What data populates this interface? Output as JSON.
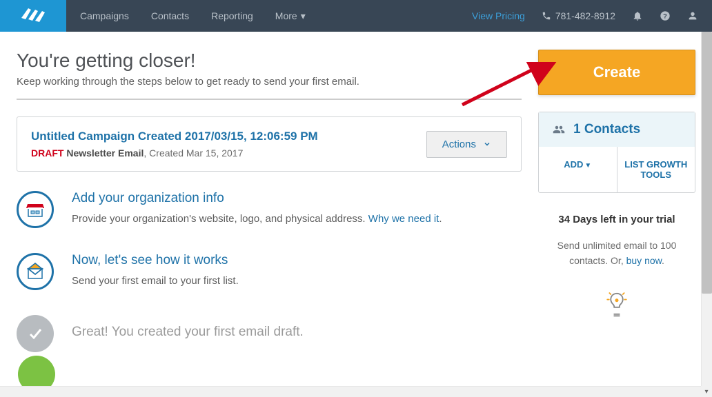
{
  "topnav": {
    "items": [
      "Campaigns",
      "Contacts",
      "Reporting",
      "More"
    ],
    "viewPricing": "View Pricing",
    "phone": "781-482-8912"
  },
  "header": {
    "title": "You're getting closer!",
    "subtitle": "Keep working through the steps below to get ready to send your first email."
  },
  "createBtn": "Create",
  "campaign": {
    "title": "Untitled Campaign Created 2017/03/15, 12:06:59 PM",
    "status": "DRAFT",
    "type": "Newsletter Email",
    "created": ", Created Mar 15, 2017",
    "actions": "Actions"
  },
  "steps": [
    {
      "title": "Add your organization info",
      "body": "Provide your organization's website, logo, and physical address. ",
      "link": "Why we need it"
    },
    {
      "title": "Now, let's see how it works",
      "body": "Send your first email to your first list."
    },
    {
      "title_done": "Great! You created your first email draft."
    }
  ],
  "contactsWidget": {
    "title": "1 Contacts",
    "add": "ADD",
    "growth": "LIST GROWTH TOOLS"
  },
  "trial": {
    "days": "34 Days left in your trial",
    "sub1": "Send unlimited email to 100 contacts. Or, ",
    "link": "buy now",
    "sub2": "."
  }
}
